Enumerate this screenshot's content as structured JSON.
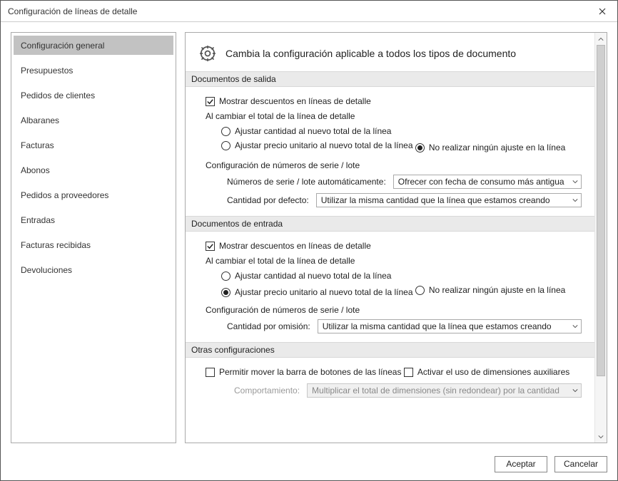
{
  "window": {
    "title": "Configuración de líneas de detalle"
  },
  "sidebar": {
    "items": [
      {
        "label": "Configuración general",
        "active": true
      },
      {
        "label": "Presupuestos",
        "active": false
      },
      {
        "label": "Pedidos de clientes",
        "active": false
      },
      {
        "label": "Albaranes",
        "active": false
      },
      {
        "label": "Facturas",
        "active": false
      },
      {
        "label": "Abonos",
        "active": false
      },
      {
        "label": "Pedidos a proveedores",
        "active": false
      },
      {
        "label": "Entradas",
        "active": false
      },
      {
        "label": "Facturas recibidas",
        "active": false
      },
      {
        "label": "Devoluciones",
        "active": false
      }
    ]
  },
  "header": {
    "title": "Cambia la configuración aplicable a todos los tipos de documento"
  },
  "sections": {
    "out": {
      "title": "Documentos de salida",
      "show_discounts": {
        "label": "Mostrar descuentos en líneas de detalle",
        "checked": true
      },
      "change_total_label": "Al cambiar el total de la línea de detalle",
      "radios": {
        "adj_qty": "Ajustar cantidad al nuevo total de la línea",
        "adj_price": "Ajustar precio unitario al nuevo total de la línea",
        "no_adj": "No realizar ningún ajuste en la línea",
        "selected": "no_adj"
      },
      "serial_header": "Configuración de números de serie / lote",
      "auto_label": "Números de serie / lote automáticamente:",
      "auto_select": "Ofrecer con fecha de consumo más antigua",
      "qty_label": "Cantidad por defecto:",
      "qty_select": "Utilizar la misma cantidad que la línea que estamos creando"
    },
    "in": {
      "title": "Documentos de entrada",
      "show_discounts": {
        "label": "Mostrar descuentos en líneas de detalle",
        "checked": true
      },
      "change_total_label": "Al cambiar el total de la línea de detalle",
      "radios": {
        "adj_qty": "Ajustar cantidad al nuevo total de la línea",
        "adj_price": "Ajustar precio unitario al nuevo total de la línea",
        "no_adj": "No realizar ningún ajuste en la línea",
        "selected": "adj_price"
      },
      "serial_header": "Configuración de números de serie / lote",
      "qty_label": "Cantidad por omisión:",
      "qty_select": "Utilizar la misma cantidad que la línea que estamos creando"
    },
    "other": {
      "title": "Otras configuraciones",
      "move_bar": {
        "label": "Permitir mover la barra de botones de las líneas",
        "checked": false
      },
      "aux_dim": {
        "label": "Activar el uso de dimensiones auxiliares",
        "checked": false
      },
      "behavior_label": "Comportamiento:",
      "behavior_select": "Multiplicar el total de dimensiones (sin redondear) por la cantidad"
    }
  },
  "buttons": {
    "accept": "Aceptar",
    "cancel": "Cancelar"
  }
}
